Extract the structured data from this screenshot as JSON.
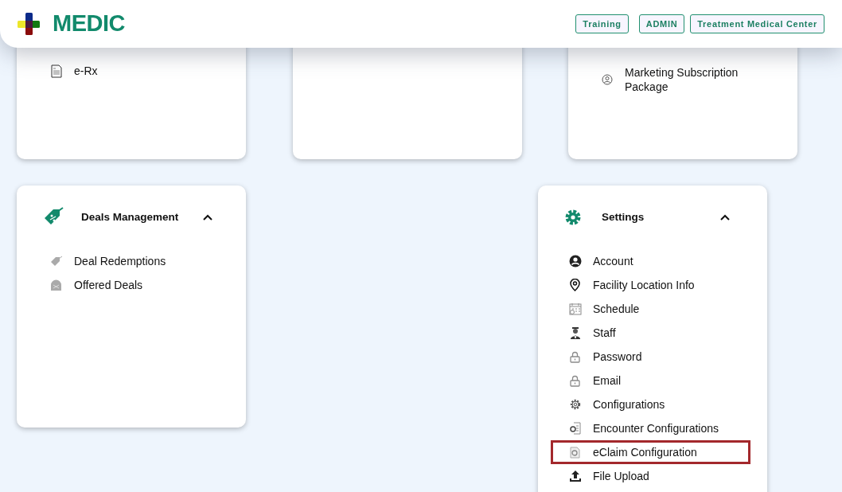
{
  "header": {
    "logo_text": "MEDIC",
    "badges": [
      "Training",
      "ADMIN",
      "Treatment Medical Center"
    ]
  },
  "top_cards": [
    {
      "kind": "list",
      "items": [
        {
          "label": "e-Rx"
        }
      ]
    },
    {
      "kind": "blank"
    },
    {
      "kind": "list",
      "items": [
        {
          "label": "Marketing Subscription Package"
        }
      ]
    }
  ],
  "sections": [
    {
      "title": "Deals Management",
      "expanded": true,
      "items": [
        {
          "label": "Deal Redemptions",
          "highlighted": false
        },
        {
          "label": "Offered Deals",
          "highlighted": false
        }
      ]
    },
    {
      "title": "Settings",
      "expanded": true,
      "items": [
        {
          "label": "Account",
          "highlighted": false
        },
        {
          "label": "Facility Location Info",
          "highlighted": false
        },
        {
          "label": "Schedule",
          "highlighted": false
        },
        {
          "label": "Staff",
          "highlighted": false
        },
        {
          "label": "Password",
          "highlighted": false
        },
        {
          "label": "Email",
          "highlighted": false
        },
        {
          "label": "Configurations",
          "highlighted": false
        },
        {
          "label": "Encounter Configurations",
          "highlighted": false
        },
        {
          "label": "eClaim Configuration",
          "highlighted": true
        },
        {
          "label": "File Upload",
          "highlighted": false
        }
      ]
    }
  ]
}
